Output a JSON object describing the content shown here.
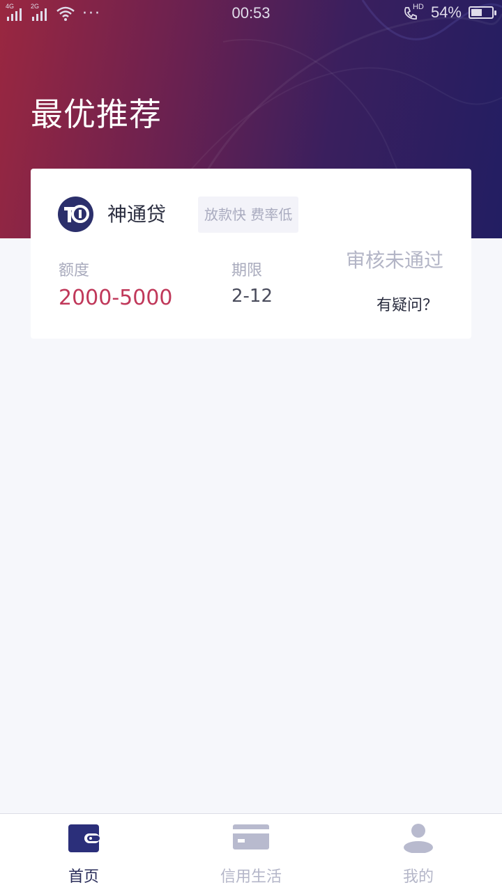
{
  "status_bar": {
    "sim1_tag": "4G",
    "sim2_tag": "2G",
    "more": "···",
    "time": "00:53",
    "call_icon_text": "HD",
    "battery_percent": "54%",
    "battery_level": 0.54
  },
  "header": {
    "title": "最优推荐"
  },
  "product": {
    "name": "神通贷",
    "tag": "放款快 费率低",
    "amount_label": "额度",
    "amount_value": "2000-5000",
    "term_label": "期限",
    "term_value": "2-12",
    "status": "审核未通过",
    "question": "有疑问？"
  },
  "tabbar": {
    "items": [
      {
        "label": "首页",
        "icon": "wallet-icon",
        "active": true
      },
      {
        "label": "信用生活",
        "icon": "card-icon",
        "active": false
      },
      {
        "label": "我的",
        "icon": "user-icon",
        "active": false
      }
    ]
  },
  "colors": {
    "accent_red": "#c0385a",
    "hero_start": "#9a2740",
    "hero_end": "#221e62",
    "tab_active": "#2a2d5a",
    "tab_inactive": "#b4b6c8"
  }
}
